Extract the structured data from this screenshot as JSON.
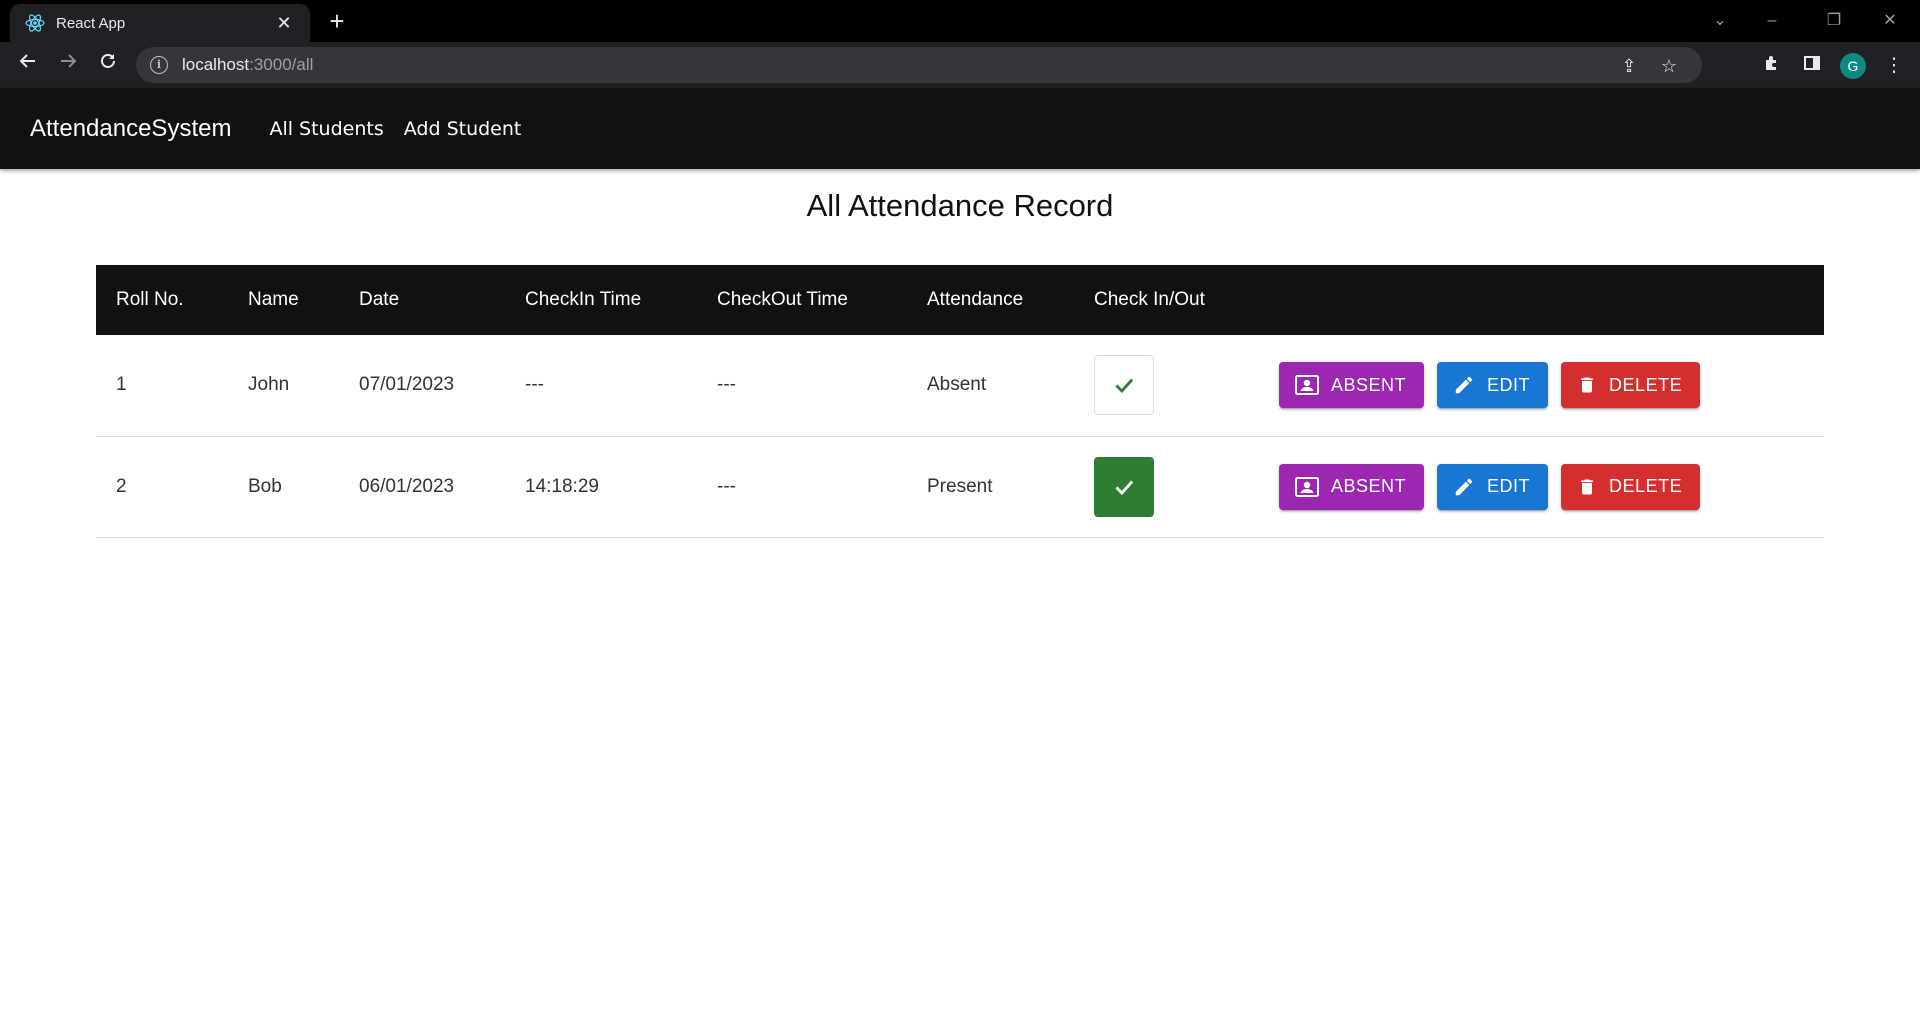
{
  "browser": {
    "tab_title": "React App",
    "url_host": "localhost",
    "url_path": ":3000/all",
    "avatar_letter": "G"
  },
  "appbar": {
    "brand": "AttendanceSystem",
    "links": [
      "All Students",
      "Add Student"
    ]
  },
  "page": {
    "title": "All Attendance Record"
  },
  "table": {
    "headers": [
      "Roll No.",
      "Name",
      "Date",
      "CheckIn Time",
      "CheckOut Time",
      "Attendance",
      "Check In/Out"
    ],
    "rows": [
      {
        "roll": "1",
        "name": "John",
        "date": "07/01/2023",
        "checkin": "---",
        "checkout": "---",
        "attendance": "Absent",
        "checked": false
      },
      {
        "roll": "2",
        "name": "Bob",
        "date": "06/01/2023",
        "checkin": "14:18:29",
        "checkout": "---",
        "attendance": "Present",
        "checked": true
      }
    ],
    "actions": {
      "absent": "ABSENT",
      "edit": "EDIT",
      "delete": "DELETE"
    }
  },
  "colors": {
    "absent_button": "#9c27b0",
    "edit_button": "#1976d2",
    "delete_button": "#d32f2f",
    "checked_box": "#2e7d32",
    "appbar": "#111111"
  },
  "icons": {
    "tab_favicon": "react-logo-icon",
    "absent": "contact-card-icon",
    "edit": "pencil-icon",
    "delete": "trash-icon",
    "check": "checkmark-icon"
  }
}
